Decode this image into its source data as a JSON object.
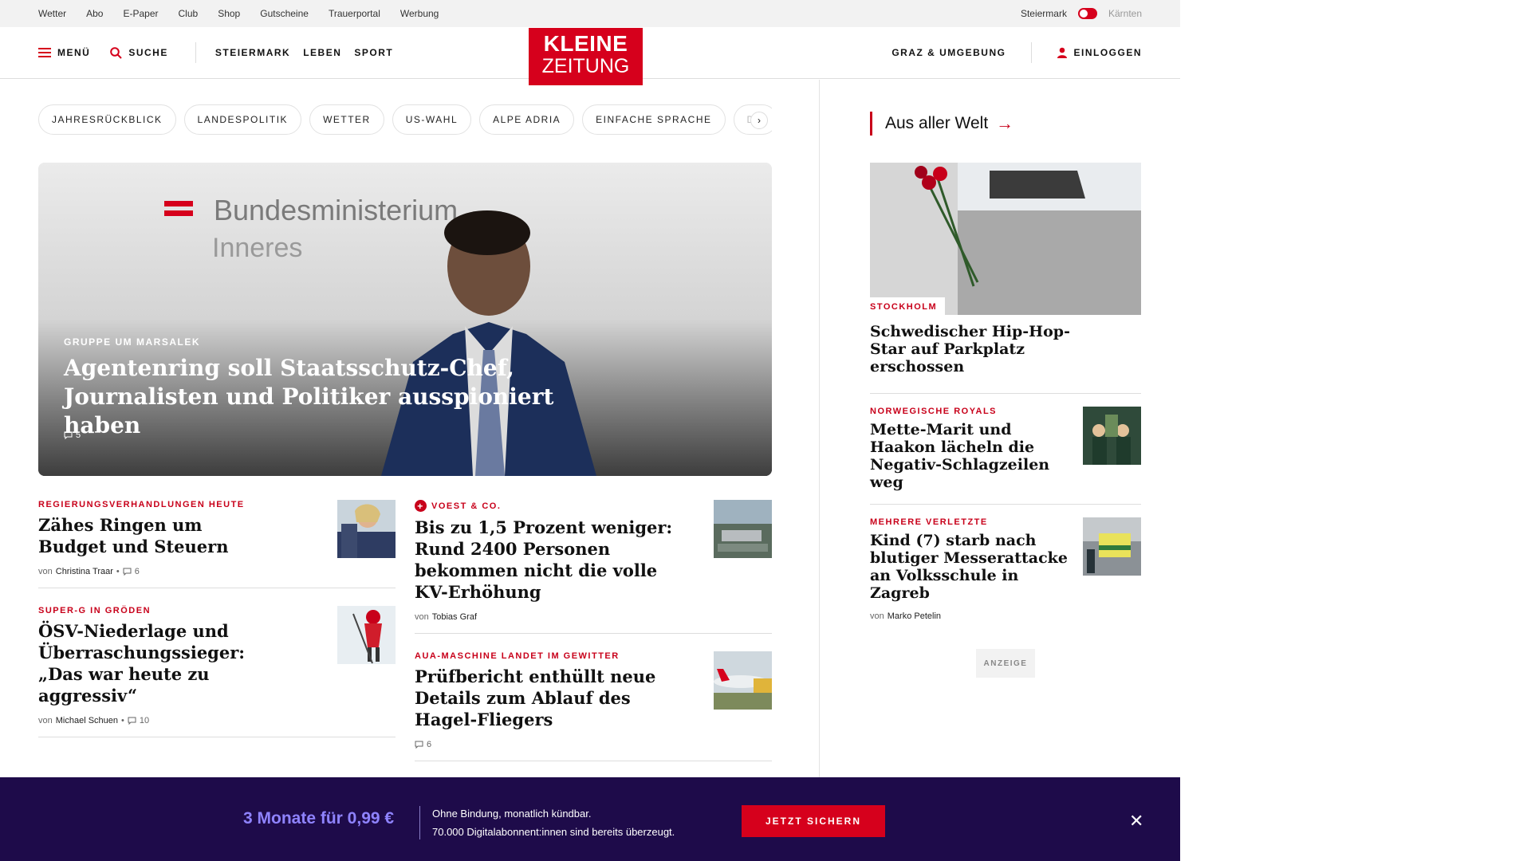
{
  "utility": {
    "links": [
      "Wetter",
      "Abo",
      "E-Paper",
      "Club",
      "Shop",
      "Gutscheine",
      "Trauerportal",
      "Werbung"
    ],
    "region_active": "Steiermark",
    "region_inactive": "Kärnten"
  },
  "nav": {
    "menu": "MENÜ",
    "search": "SUCHE",
    "sections": [
      "STEIERMARK",
      "LEBEN",
      "SPORT"
    ],
    "logo_line1": "KLEINE",
    "logo_line2": "ZEITUNG",
    "local": "GRAZ & UMGEBUNG",
    "login": "EINLOGGEN"
  },
  "chips": [
    "JAHRESRÜCKBLICK",
    "LANDESPOLITIK",
    "WETTER",
    "US-WAHL",
    "ALPE ADRIA",
    "EINFACHE SPRACHE",
    "DO"
  ],
  "hero": {
    "kicker": "GRUPPE UM MARSALEK",
    "title": "Agentenring soll Staatsschutz-Chef, Journalisten und Politiker ausspioniert haben",
    "comments": "5",
    "sign_line1": "Bundesministerium",
    "sign_line2": "Inneres"
  },
  "articles_left": [
    {
      "kicker": "REGIERUNGSVERHANDLUNGEN HEUTE",
      "title": "Zähes Ringen um Budget und Steuern",
      "by": "von",
      "author": "Christina Traar",
      "comments": "6"
    },
    {
      "kicker": "SUPER-G IN GRÖDEN",
      "title": "ÖSV-Niederlage und Überraschungssieger: „Das war heute zu aggressiv“",
      "by": "von",
      "author": "Michael Schuen",
      "comments": "10"
    }
  ],
  "articles_right": [
    {
      "kicker": "VOEST & CO.",
      "title": "Bis zu 1,5 Prozent weniger: Rund 2400 Personen bekommen nicht die volle KV-Erhöhung",
      "by": "von",
      "author": "Tobias Graf"
    },
    {
      "kicker": "AUA-MASCHINE LANDET IM GEWITTER",
      "title": "Prüfbericht enthüllt neue Details zum Ablauf des Hagel-Fliegers",
      "comments": "6"
    }
  ],
  "side": {
    "section_title": "Aus aller Welt",
    "lead": {
      "tag": "STOCKHOLM",
      "title": "Schwedischer Hip-Hop-Star auf Parkplatz erschossen"
    },
    "items": [
      {
        "kicker": "NORWEGISCHE ROYALS",
        "title": "Mette-Marit und Haakon lächeln die Negativ-Schlagzeilen weg"
      },
      {
        "kicker": "MEHRERE VERLETZTE",
        "title": "Kind (7) starb nach blutiger Messerattacke an Volksschule in Zagreb",
        "by": "von",
        "author": "Marko Petelin"
      }
    ],
    "ad": "ANZEIGE"
  },
  "banner": {
    "price": "3 Monate für 0,99 €",
    "line1": "Ohne Bindung, monatlich kündbar.",
    "line2": "70.000 Digitalabonnent:innen sind bereits überzeugt.",
    "cta": "JETZT SICHERN"
  },
  "colors": {
    "brand_red": "#d6001c",
    "banner_bg": "#1e0b4a",
    "price_purple": "#8f83ff"
  }
}
